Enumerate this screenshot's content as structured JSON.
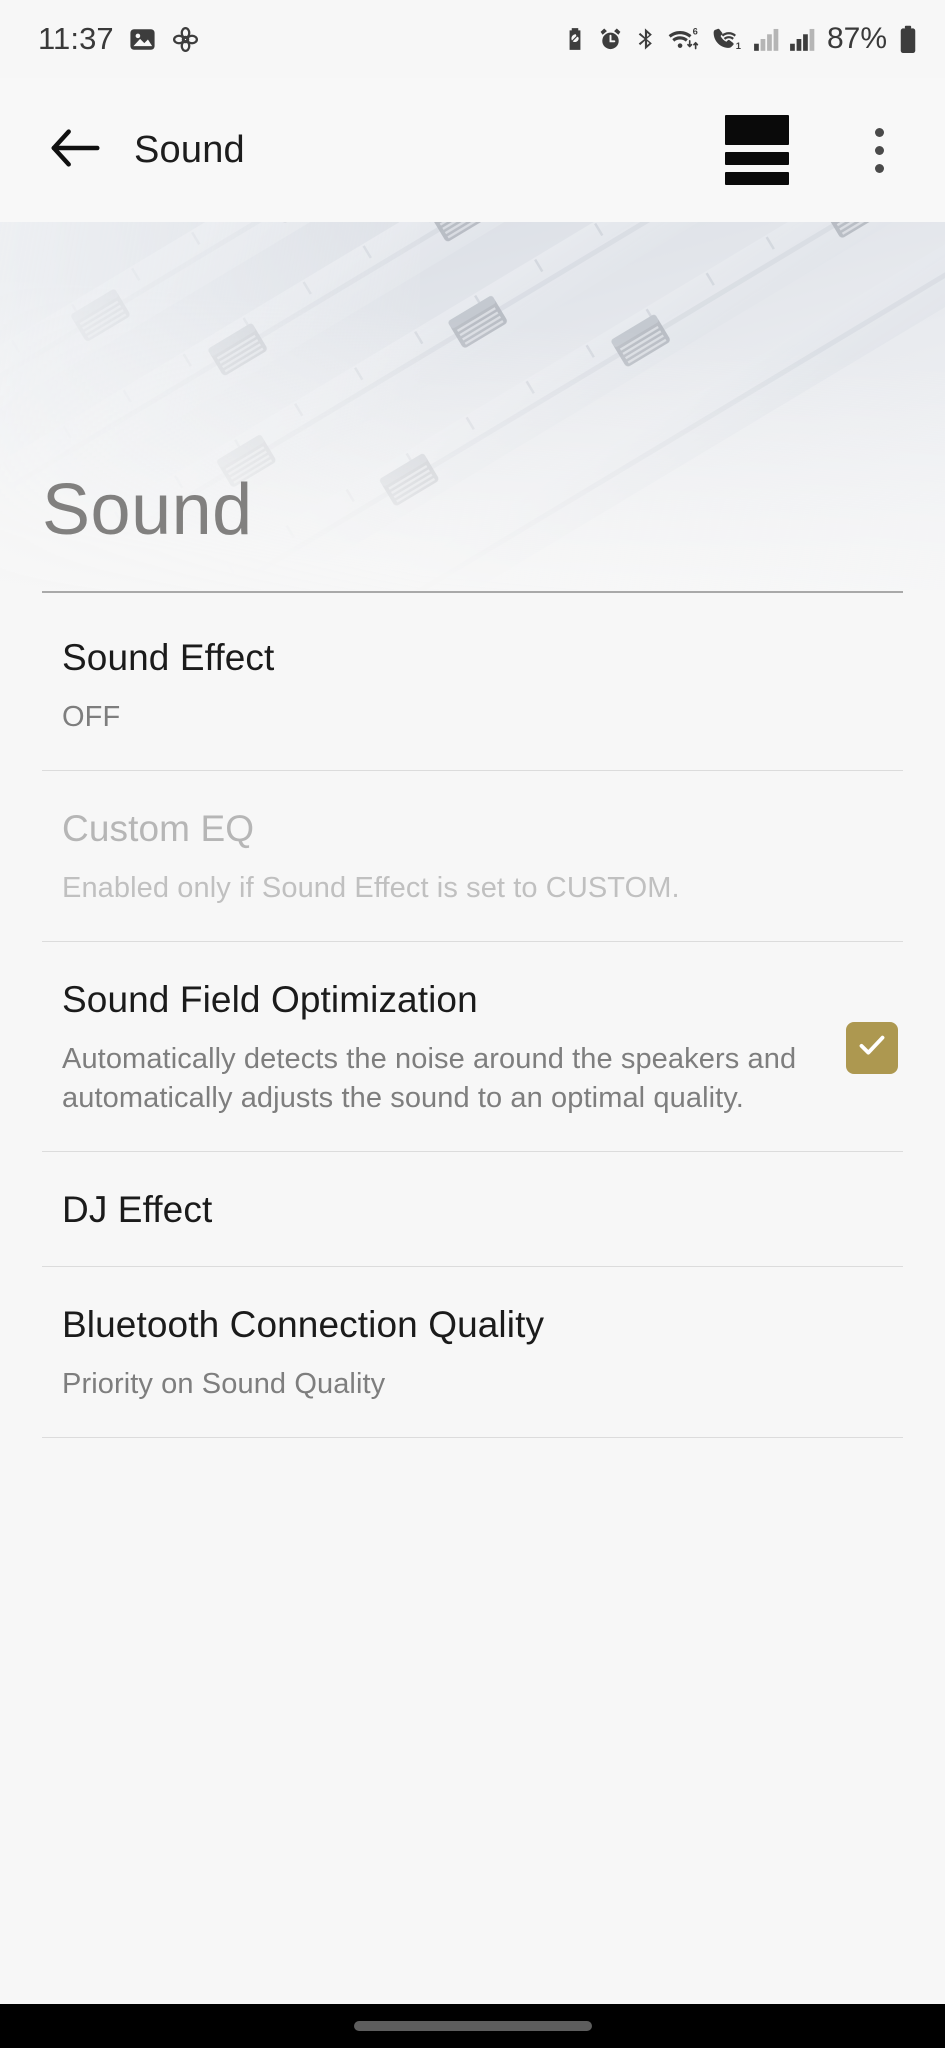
{
  "status_bar": {
    "time": "11:37",
    "left_icons": [
      "photo-icon",
      "flower-icon"
    ],
    "right_icons": [
      "battery-saver-icon",
      "alarm-icon",
      "bluetooth-icon",
      "wifi-6-icon",
      "wifi-calling-icon",
      "signal-1-icon",
      "signal-2-icon"
    ],
    "battery_percent": "87%",
    "battery_icon": "battery-icon"
  },
  "app_bar": {
    "back_icon": "back-arrow-icon",
    "title": "Sound",
    "queue_icon": "queue-list-icon",
    "overflow_icon": "more-options-icon"
  },
  "hero": {
    "title": "Sound",
    "image": "audio-mixer-faders-photo"
  },
  "settings": [
    {
      "title": "Sound Effect",
      "subtitle": "OFF",
      "disabled": false,
      "has_checkbox": false,
      "checked": false
    },
    {
      "title": "Custom EQ",
      "subtitle": "Enabled only if Sound Effect is set to CUSTOM.",
      "disabled": true,
      "has_checkbox": false,
      "checked": false
    },
    {
      "title": "Sound Field Optimization",
      "subtitle": "Automatically detects the noise around the speakers and automatically adjusts the sound to an optimal quality.",
      "disabled": false,
      "has_checkbox": true,
      "checked": true
    },
    {
      "title": "DJ Effect",
      "subtitle": "",
      "disabled": false,
      "has_checkbox": false,
      "checked": false
    },
    {
      "title": "Bluetooth Connection Quality",
      "subtitle": "Priority on Sound Quality",
      "disabled": false,
      "has_checkbox": false,
      "checked": false
    }
  ],
  "nav_bar": {
    "gesture_pill": "home-gesture-pill"
  },
  "colors": {
    "accent_checkbox": "#ad9850",
    "page_background": "#f7f7f7",
    "title_text": "#1b1b1b",
    "subtitle_text": "#7e7e7e",
    "disabled_text": "#b6b6b6",
    "hero_title": "#81807f",
    "nav_bar": "#000000"
  }
}
